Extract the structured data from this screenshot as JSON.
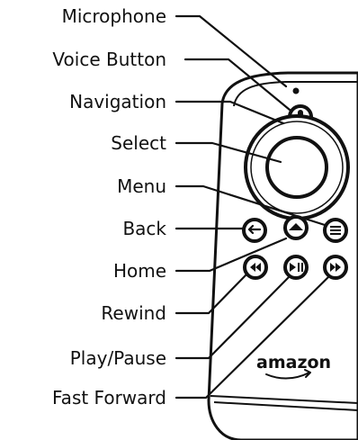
{
  "labels": {
    "microphone": "Microphone",
    "voice_button": "Voice Button",
    "navigation": "Navigation",
    "select": "Select",
    "menu": "Menu",
    "back": "Back",
    "home": "Home",
    "rewind": "Rewind",
    "play_pause": "Play/Pause",
    "fast_forward": "Fast Forward"
  },
  "remote": {
    "brand_text": "amazon"
  },
  "icons": [
    "microphone-icon",
    "back-arrow-icon",
    "home-icon",
    "menu-icon",
    "rewind-icon",
    "play-pause-icon",
    "fast-forward-icon",
    "amazon-smile-icon"
  ]
}
